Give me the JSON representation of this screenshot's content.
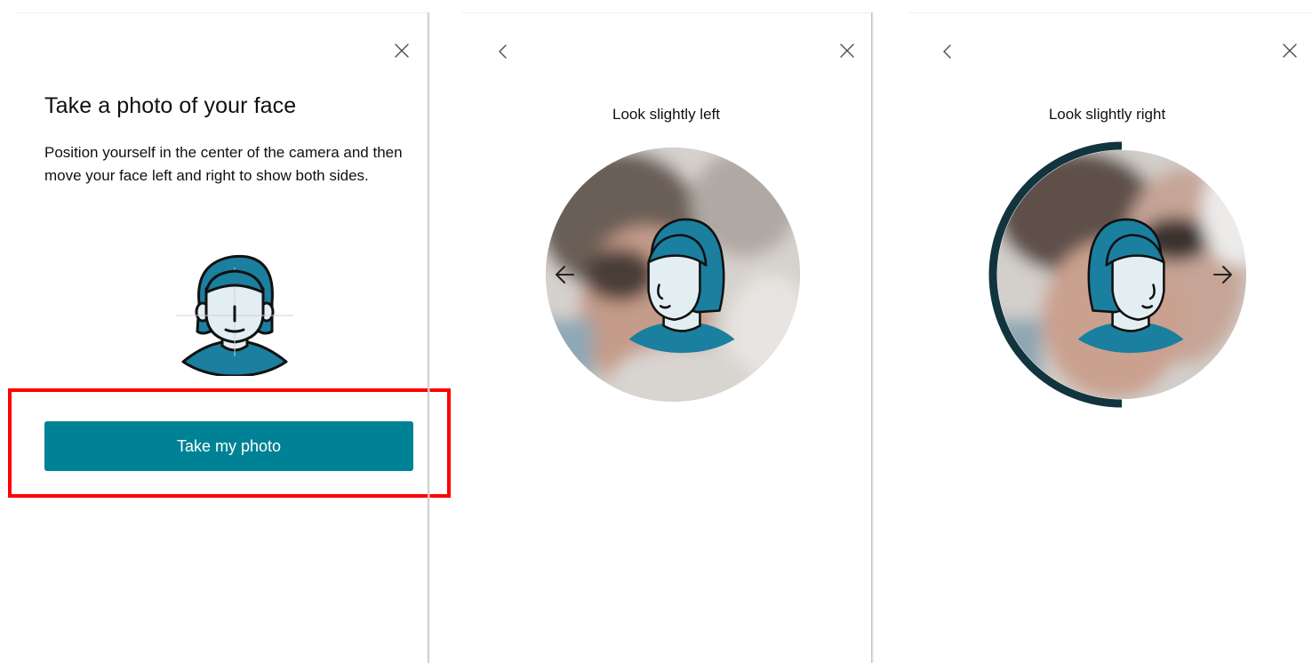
{
  "panels": {
    "intro": {
      "title": "Take a photo of your face",
      "description": "Position yourself in the center of the camera and then move your face left and right to show both sides.",
      "button_label": "Take my photo",
      "close_icon": "close-icon",
      "illustration_icon": "face-illustration"
    },
    "left": {
      "instruction": "Look slightly left",
      "back_icon": "chevron-left-icon",
      "close_icon": "close-icon",
      "direction_icon": "arrow-left-icon"
    },
    "right": {
      "instruction": "Look slightly right",
      "back_icon": "chevron-left-icon",
      "close_icon": "close-icon",
      "direction_icon": "arrow-right-icon",
      "progress_fraction": 0.5
    }
  },
  "colors": {
    "accent": "#008296",
    "illustration_blue": "#1b7f9f",
    "illustration_face": "#e3eef3",
    "progress_ring": "#12343f",
    "highlight": "#ff0000",
    "text": "#0f1111"
  }
}
